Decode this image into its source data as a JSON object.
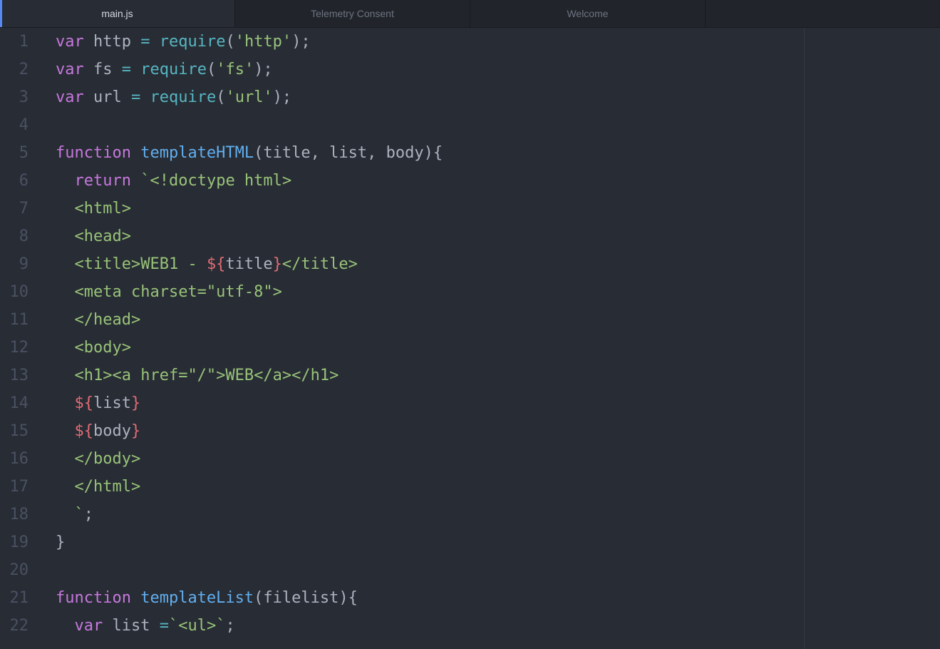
{
  "tabs": [
    {
      "label": "main.js",
      "active": true
    },
    {
      "label": "Telemetry Consent",
      "active": false
    },
    {
      "label": "Welcome",
      "active": false
    }
  ],
  "colors": {
    "background": "#282c34",
    "keyword": "#c678dd",
    "function": "#61afef",
    "operator": "#56b6c2",
    "string": "#98c379",
    "template_brace": "#e06c75",
    "plain": "#abb2bf",
    "gutter": "#495162",
    "accent": "#568af2"
  },
  "lines": [
    {
      "n": "1",
      "tokens": [
        [
          "k",
          "var"
        ],
        [
          "p",
          " http "
        ],
        [
          "o",
          "="
        ],
        [
          "p",
          " "
        ],
        [
          "o",
          "require"
        ],
        [
          "p",
          "("
        ],
        [
          "s",
          "'http'"
        ],
        [
          "p",
          ");"
        ]
      ]
    },
    {
      "n": "2",
      "tokens": [
        [
          "k",
          "var"
        ],
        [
          "p",
          " fs "
        ],
        [
          "o",
          "="
        ],
        [
          "p",
          " "
        ],
        [
          "o",
          "require"
        ],
        [
          "p",
          "("
        ],
        [
          "s",
          "'fs'"
        ],
        [
          "p",
          ");"
        ]
      ]
    },
    {
      "n": "3",
      "tokens": [
        [
          "k",
          "var"
        ],
        [
          "p",
          " url "
        ],
        [
          "o",
          "="
        ],
        [
          "p",
          " "
        ],
        [
          "o",
          "require"
        ],
        [
          "p",
          "("
        ],
        [
          "s",
          "'url'"
        ],
        [
          "p",
          ");"
        ]
      ]
    },
    {
      "n": "4",
      "tokens": []
    },
    {
      "n": "5",
      "tokens": [
        [
          "k",
          "function"
        ],
        [
          "p",
          " "
        ],
        [
          "f",
          "templateHTML"
        ],
        [
          "p",
          "(title, list, body){"
        ]
      ]
    },
    {
      "n": "6",
      "tokens": [
        [
          "p",
          "  "
        ],
        [
          "k",
          "return"
        ],
        [
          "p",
          " "
        ],
        [
          "s",
          "`<!doctype html>"
        ]
      ]
    },
    {
      "n": "7",
      "tokens": [
        [
          "p",
          "  "
        ],
        [
          "s",
          "<html>"
        ]
      ]
    },
    {
      "n": "8",
      "tokens": [
        [
          "p",
          "  "
        ],
        [
          "s",
          "<head>"
        ]
      ]
    },
    {
      "n": "9",
      "tokens": [
        [
          "p",
          "  "
        ],
        [
          "s",
          "<title>WEB1 - "
        ],
        [
          "t",
          "${"
        ],
        [
          "p",
          "title"
        ],
        [
          "t",
          "}"
        ],
        [
          "s",
          "</title>"
        ]
      ]
    },
    {
      "n": "10",
      "tokens": [
        [
          "p",
          "  "
        ],
        [
          "s",
          "<meta charset=\"utf-8\">"
        ]
      ]
    },
    {
      "n": "11",
      "tokens": [
        [
          "p",
          "  "
        ],
        [
          "s",
          "</head>"
        ]
      ]
    },
    {
      "n": "12",
      "tokens": [
        [
          "p",
          "  "
        ],
        [
          "s",
          "<body>"
        ]
      ]
    },
    {
      "n": "13",
      "tokens": [
        [
          "p",
          "  "
        ],
        [
          "s",
          "<h1><a href=\"/\">WEB</a></h1>"
        ]
      ]
    },
    {
      "n": "14",
      "tokens": [
        [
          "p",
          "  "
        ],
        [
          "t",
          "${"
        ],
        [
          "p",
          "list"
        ],
        [
          "t",
          "}"
        ]
      ]
    },
    {
      "n": "15",
      "tokens": [
        [
          "p",
          "  "
        ],
        [
          "t",
          "${"
        ],
        [
          "p",
          "body"
        ],
        [
          "t",
          "}"
        ]
      ]
    },
    {
      "n": "16",
      "tokens": [
        [
          "p",
          "  "
        ],
        [
          "s",
          "</body>"
        ]
      ]
    },
    {
      "n": "17",
      "tokens": [
        [
          "p",
          "  "
        ],
        [
          "s",
          "</html>"
        ]
      ]
    },
    {
      "n": "18",
      "tokens": [
        [
          "p",
          "  "
        ],
        [
          "s",
          "`"
        ],
        [
          "p",
          ";"
        ]
      ]
    },
    {
      "n": "19",
      "tokens": [
        [
          "p",
          "}"
        ]
      ]
    },
    {
      "n": "20",
      "tokens": []
    },
    {
      "n": "21",
      "tokens": [
        [
          "k",
          "function"
        ],
        [
          "p",
          " "
        ],
        [
          "f",
          "templateList"
        ],
        [
          "p",
          "(filelist){"
        ]
      ]
    },
    {
      "n": "22",
      "tokens": [
        [
          "p",
          "  "
        ],
        [
          "k",
          "var"
        ],
        [
          "p",
          " list "
        ],
        [
          "o",
          "="
        ],
        [
          "s",
          "`<ul>`"
        ],
        [
          "p",
          ";"
        ]
      ]
    }
  ]
}
